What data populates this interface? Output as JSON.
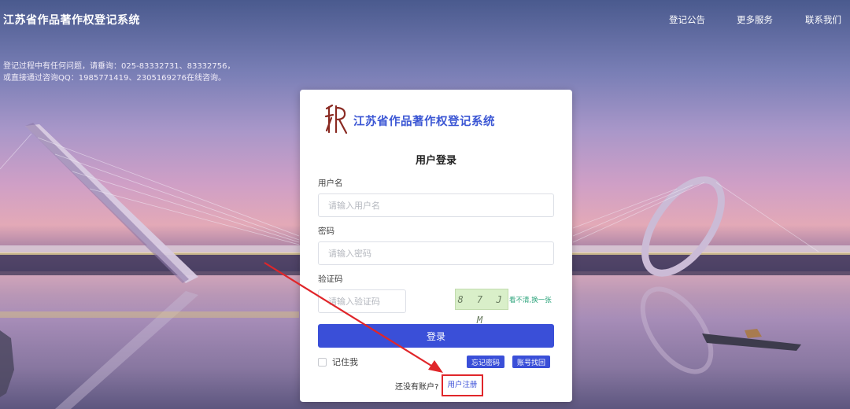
{
  "header": {
    "site_title": "江苏省作品著作权登记系统",
    "nav": [
      "登记公告",
      "更多服务",
      "联系我们"
    ]
  },
  "notice": {
    "line1": "登记过程中有任何问题，请垂询：025-83332731、83332756，",
    "line2": "或直接通过咨询QQ：1985771419、2305169276在线咨询。"
  },
  "login": {
    "system_title": "江苏省作品著作权登记系统",
    "form_title": "用户登录",
    "username_label": "用户名",
    "username_placeholder": "请输入用户名",
    "password_label": "密码",
    "password_placeholder": "请输入密码",
    "captcha_label": "验证码",
    "captcha_placeholder": "请输入验证码",
    "captcha_code": "8 7 J M",
    "captcha_refresh": "看不清,换一张",
    "login_button": "登录",
    "remember_me": "记住我",
    "forgot_password": "忘记密码",
    "recover_account": "账号找回",
    "no_account": "还没有账户?",
    "register": "用户注册"
  },
  "colors": {
    "primary": "#3a4fd8",
    "highlight": "#e0262a",
    "captcha_bg": "#d9efc9"
  }
}
